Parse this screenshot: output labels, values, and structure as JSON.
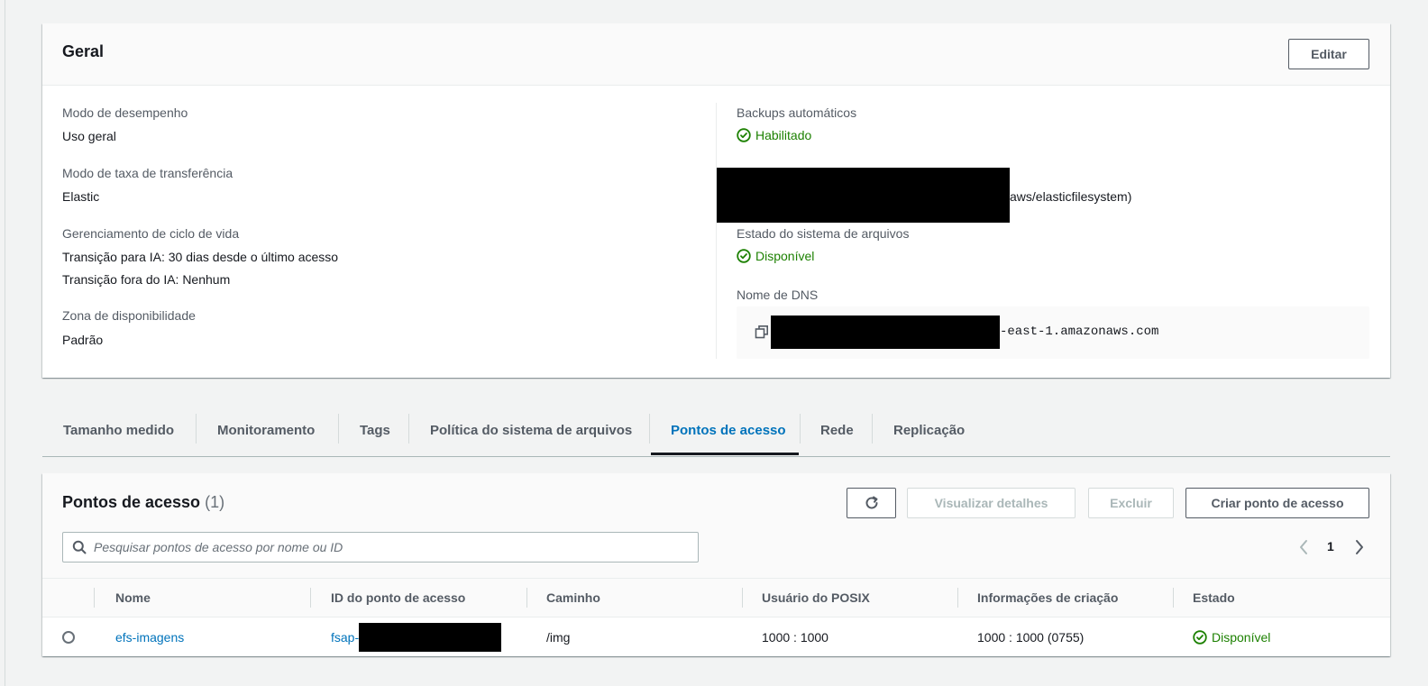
{
  "general": {
    "title": "Geral",
    "edit_label": "Editar",
    "performance_mode": {
      "label": "Modo de desempenho",
      "value": "Uso geral"
    },
    "throughput_mode": {
      "label": "Modo de taxa de transferência",
      "value": "Elastic"
    },
    "lifecycle": {
      "label": "Gerenciamento de ciclo de vida",
      "value_ia": "Transição para IA: 30 dias desde o último acesso",
      "value_out": "Transição fora do IA: Nenhum"
    },
    "availability_zone": {
      "label": "Zona de disponibilidade",
      "value": "Padrão"
    },
    "backups": {
      "label": "Backups automáticos",
      "value": "Habilitado"
    },
    "encryption_value_tail": "aws/elasticfilesystem)",
    "fs_state": {
      "label": "Estado do sistema de arquivos",
      "value": "Disponível"
    },
    "dns": {
      "label": "Nome de DNS",
      "value_tail": "-east-1.amazonaws.com"
    }
  },
  "tabs": [
    {
      "label": "Tamanho medido"
    },
    {
      "label": "Monitoramento"
    },
    {
      "label": "Tags"
    },
    {
      "label": "Política do sistema de arquivos"
    },
    {
      "label": "Pontos de acesso",
      "active": true
    },
    {
      "label": "Rede"
    },
    {
      "label": "Replicação"
    }
  ],
  "access_points": {
    "title": "Pontos de acesso",
    "count": "(1)",
    "view_details_label": "Visualizar detalhes",
    "delete_label": "Excluir",
    "create_label": "Criar ponto de acesso",
    "search_placeholder": "Pesquisar pontos de acesso por nome ou ID",
    "page": "1",
    "columns": [
      "Nome",
      "ID do ponto de acesso",
      "Caminho",
      "Usuário do POSIX",
      "Informações de criação",
      "Estado"
    ],
    "rows": [
      {
        "name": "efs-imagens",
        "id_prefix": "fsap-",
        "path": "/img",
        "posix_user": "1000 : 1000",
        "creation_info": "1000 : 1000 (0755)",
        "state": "Disponível"
      }
    ]
  },
  "colors": {
    "link": "#0073bb",
    "success": "#1d8102",
    "text": "#16191f",
    "secondary_text": "#545b64",
    "page_bg": "#f2f3f3"
  },
  "icons": [
    "status-check-icon",
    "copy-icon",
    "refresh-icon",
    "search-icon",
    "chevron-left-icon",
    "chevron-right-icon"
  ]
}
